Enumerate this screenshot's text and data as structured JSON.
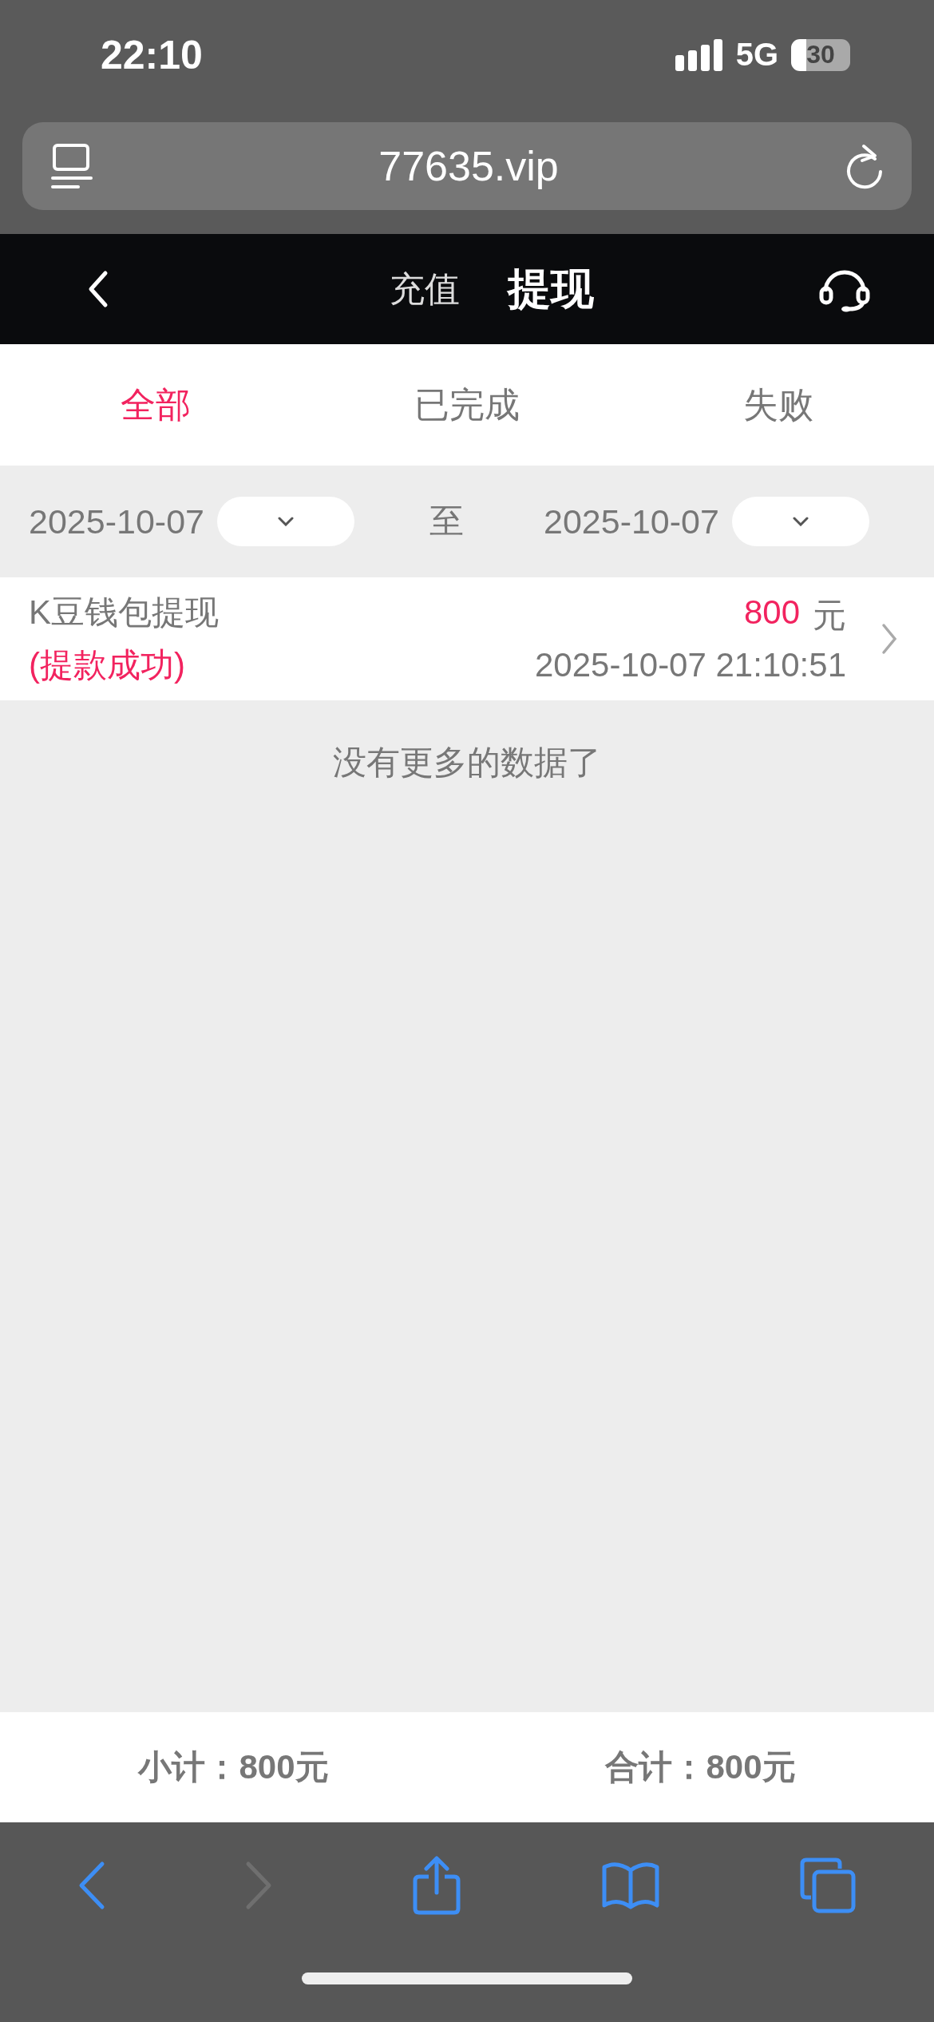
{
  "status_bar": {
    "time": "22:10",
    "network": "5G",
    "battery": "30"
  },
  "browser": {
    "url": "77635.vip"
  },
  "header": {
    "tabs": [
      {
        "label": "充值",
        "selected": false
      },
      {
        "label": "提现",
        "selected": true
      }
    ]
  },
  "filter_tabs": [
    {
      "label": "全部",
      "selected": true
    },
    {
      "label": "已完成",
      "selected": false
    },
    {
      "label": "失败",
      "selected": false
    }
  ],
  "date_range": {
    "start": "2025-10-07",
    "separator": "至",
    "end": "2025-10-07"
  },
  "records": [
    {
      "title": "K豆钱包提现",
      "status": "(提款成功)",
      "amount": "800",
      "unit": "元",
      "time": "2025-10-07 21:10:51"
    }
  ],
  "end_note": "没有更多的数据了",
  "totals": [
    {
      "text": "小计：800元"
    },
    {
      "text": "合计：800元"
    }
  ],
  "toolbar": [
    {
      "kind": "back",
      "disabled": false
    },
    {
      "kind": "forward",
      "disabled": true
    },
    {
      "kind": "share",
      "disabled": false
    },
    {
      "kind": "bookmarks",
      "disabled": false
    },
    {
      "kind": "tabs",
      "disabled": false
    }
  ]
}
